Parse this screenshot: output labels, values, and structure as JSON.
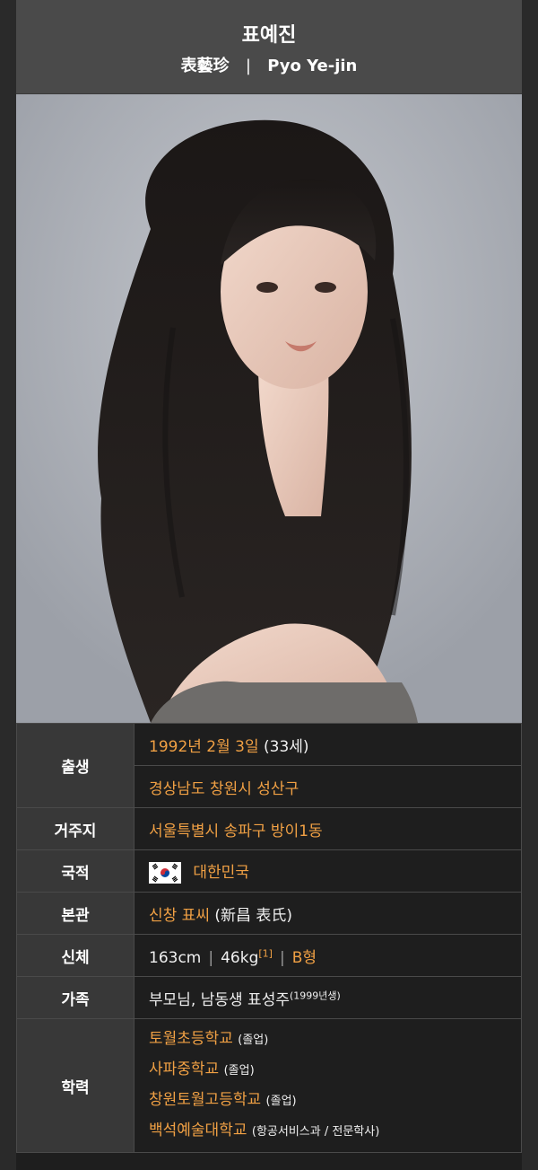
{
  "header": {
    "name_korean": "표예진",
    "name_hanja": "表藝珍",
    "separator": "|",
    "name_roman": "Pyo Ye-jin"
  },
  "photo": {
    "alt": "profile-photo"
  },
  "info": {
    "birth": {
      "label": "출생",
      "date": "1992년 2월 3일",
      "age": "(33세)",
      "place": "경상남도 창원시 성산구"
    },
    "residence": {
      "label": "거주지",
      "value": "서울특별시 송파구 방이1동"
    },
    "nationality": {
      "label": "국적",
      "value": "대한민국",
      "flag_icon": "south-korea-flag-icon"
    },
    "origin": {
      "label": "본관",
      "clan": "신창 표씨",
      "hanja": "(新昌 表氏)"
    },
    "body": {
      "label": "신체",
      "height": "163cm",
      "sep": "|",
      "weight": "46kg",
      "ref": "[1]",
      "blood": "B형"
    },
    "family": {
      "label": "가족",
      "value": "부모님, 남동생 표성주",
      "note": "(1999년생)"
    },
    "education": {
      "label": "학력",
      "schools": [
        {
          "name": "토월초등학교",
          "note": "(졸업)"
        },
        {
          "name": "사파중학교",
          "note": "(졸업)"
        },
        {
          "name": "창원토월고등학교",
          "note": "(졸업)"
        },
        {
          "name": "백석예술대학교",
          "note": "(항공서비스과 / 전문학사)"
        }
      ]
    }
  },
  "colors": {
    "link": "#f0a044",
    "header_bg": "#4a4a4a",
    "label_bg": "#383838",
    "page_bg": "#1e1e1e"
  }
}
